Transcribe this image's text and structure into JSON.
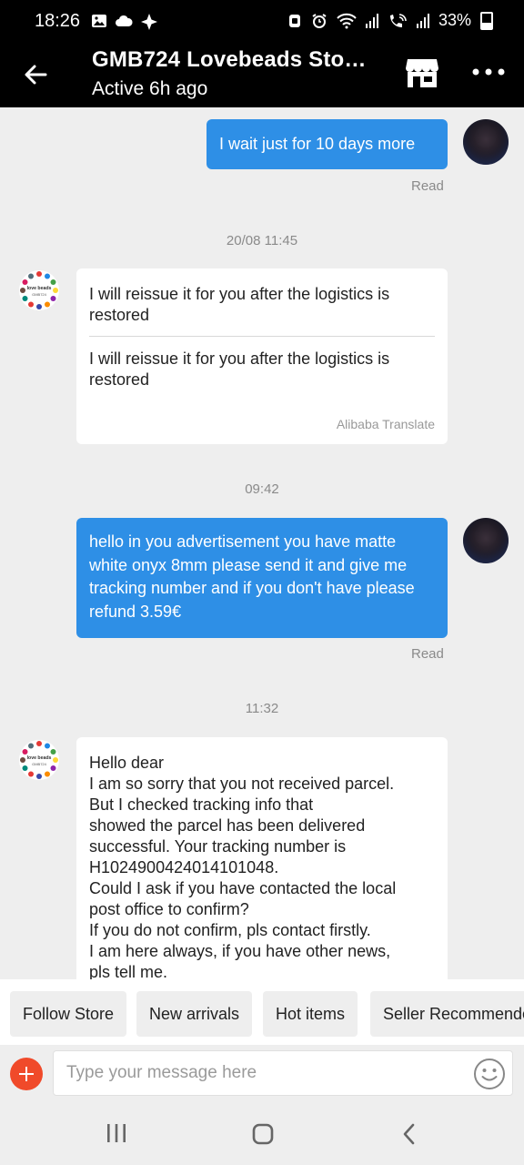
{
  "status_bar": {
    "time": "18:26",
    "battery": "33%",
    "icons_left": [
      "image-icon",
      "cloud-icon",
      "pinwheel-icon"
    ],
    "icons_right": [
      "alarm-icon",
      "wifi-icon",
      "signal-icon",
      "call-wifi-icon",
      "signal2-icon",
      "battery-icon"
    ]
  },
  "header": {
    "title": "GMB724 Lovebeads Sto…",
    "subtitle": "Active 6h ago"
  },
  "messages": [
    {
      "type": "outgoing",
      "text": "I wait just for 10 days more",
      "status": "Read"
    },
    {
      "type": "timestamp",
      "text": "20/08 11:45"
    },
    {
      "type": "incoming",
      "text": "I will reissue it for you after the logistics is restored",
      "translated": "I will reissue it for you after the logistics is restored",
      "translate_label": "Alibaba Translate"
    },
    {
      "type": "timestamp",
      "text": "09:42"
    },
    {
      "type": "outgoing",
      "text": "hello in you advertisement you have  matte white onyx 8mm please send it and give me tracking number and if you don't have please refund 3.59€",
      "status": "Read"
    },
    {
      "type": "timestamp",
      "text": "11:32"
    },
    {
      "type": "incoming",
      "lines": [
        "Hello dear",
        "I am so sorry that you not received parcel.",
        "But I checked tracking info that",
        "showed the parcel has been delivered",
        "successful. Your tracking number is",
        "H1024900424014101048.",
        "Could I ask if you have contacted the local",
        "post office to confirm?",
        "If you do not confirm, pls contact firstly.",
        "I am here always, if you have other news,",
        "pls tell me."
      ]
    }
  ],
  "store_avatar": {
    "line1": "love beads",
    "line2": "GMB724"
  },
  "quick_replies": [
    "Follow Store",
    "New arrivals",
    "Hot items",
    "Seller Recommended"
  ],
  "input": {
    "placeholder": "Type your message here",
    "value": ""
  },
  "colors": {
    "accent_blue": "#2e8fe6",
    "header_bg": "#000000",
    "plus_red": "#f04a2a"
  }
}
